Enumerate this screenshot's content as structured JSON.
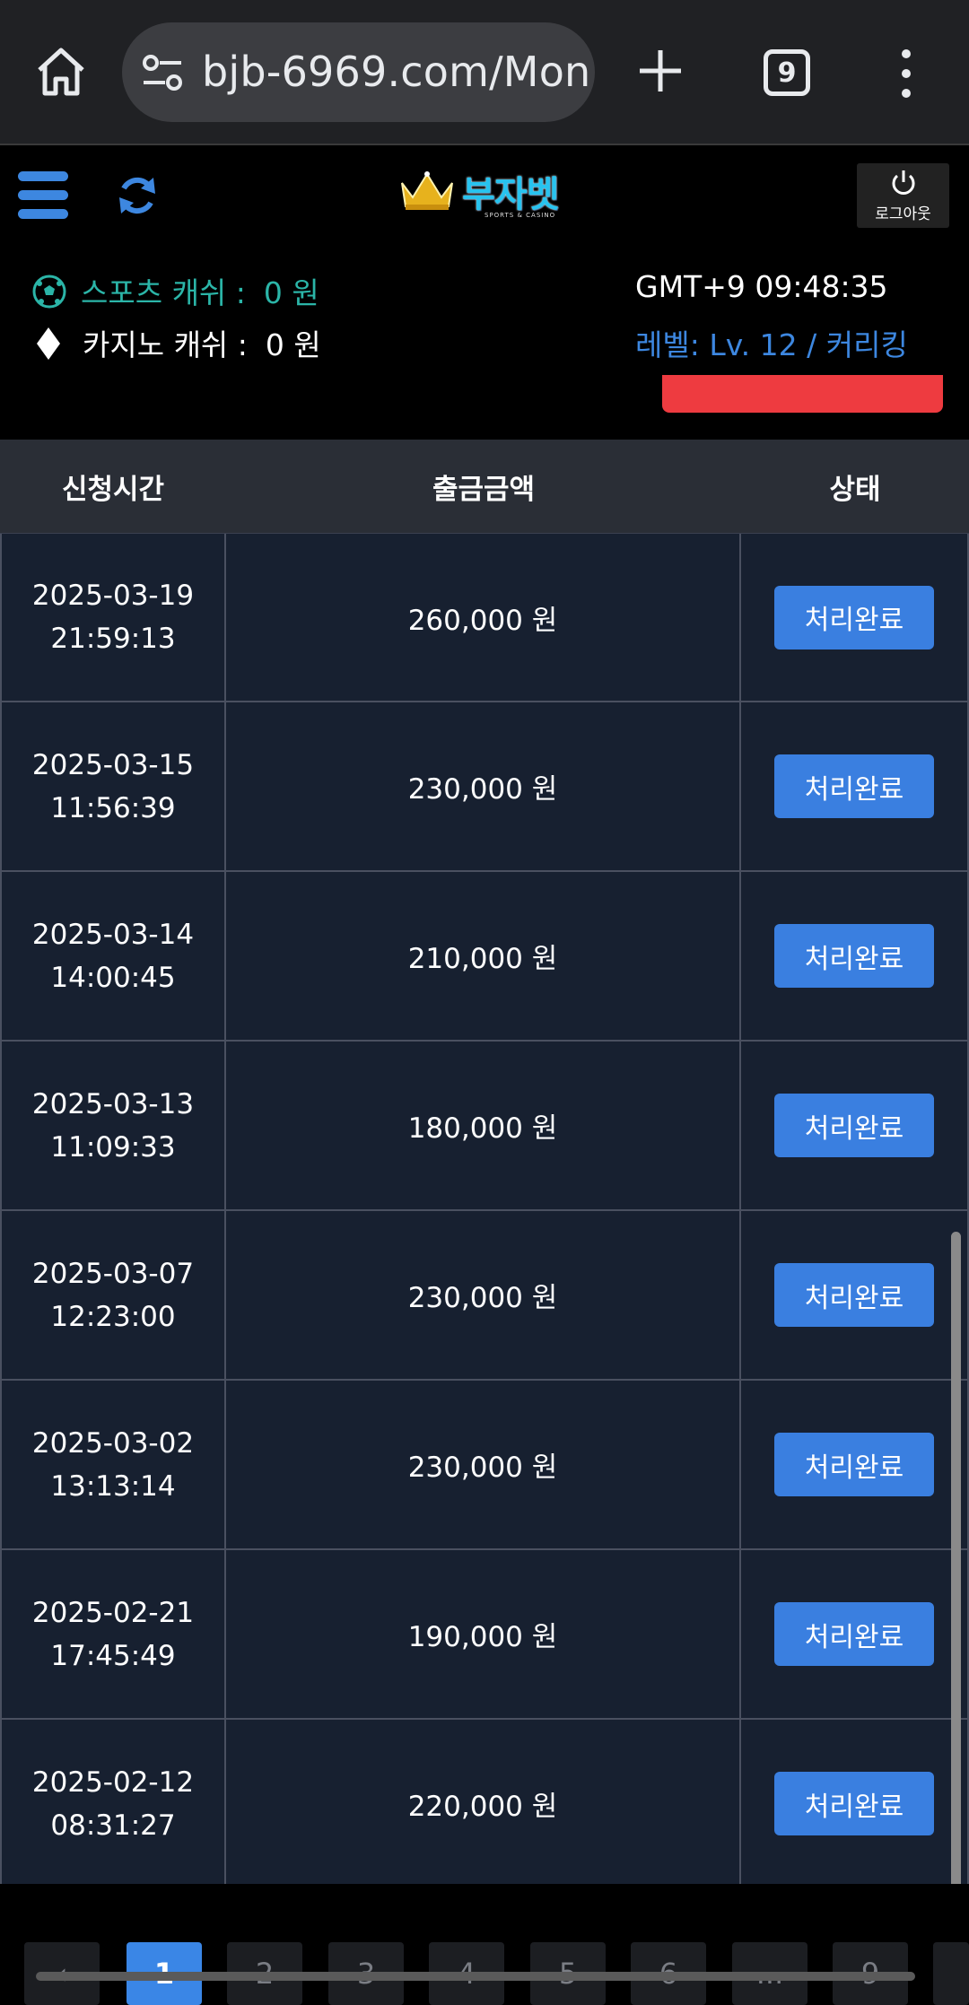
{
  "browser": {
    "url": "bjb-6969.com/Mon",
    "tab_count": "9"
  },
  "header": {
    "logo_text": "부자벳",
    "logo_sub": "SPORTS & CASINO",
    "logout_label": "로그아웃",
    "sports_label": "스포츠 캐쉬 :",
    "sports_value": "0 원",
    "casino_label": "카지노 캐쉬 :",
    "casino_value": "0 원",
    "time": "GMT+9 09:48:35",
    "level": "레벨: Lv. 12 / 커리킹",
    "accent_color": "#3d87e0",
    "sports_color": "#2bb5a8"
  },
  "table": {
    "columns": [
      "신청시간",
      "출금금액",
      "상태"
    ],
    "rows": [
      {
        "date": "2025-03-19",
        "time": "21:59:13",
        "amount": "260,000 원",
        "status": "처리완료"
      },
      {
        "date": "2025-03-15",
        "time": "11:56:39",
        "amount": "230,000 원",
        "status": "처리완료"
      },
      {
        "date": "2025-03-14",
        "time": "14:00:45",
        "amount": "210,000 원",
        "status": "처리완료"
      },
      {
        "date": "2025-03-13",
        "time": "11:09:33",
        "amount": "180,000 원",
        "status": "처리완료"
      },
      {
        "date": "2025-03-07",
        "time": "12:23:00",
        "amount": "230,000 원",
        "status": "처리완료"
      },
      {
        "date": "2025-03-02",
        "time": "13:13:14",
        "amount": "230,000 원",
        "status": "처리완료"
      },
      {
        "date": "2025-02-21",
        "time": "17:45:49",
        "amount": "190,000 원",
        "status": "처리완료"
      },
      {
        "date": "2025-02-12",
        "time": "08:31:27",
        "amount": "220,000 원",
        "status": "처리완료"
      }
    ]
  },
  "pagination": {
    "prev": "‹",
    "pages": [
      "1",
      "2",
      "3",
      "4",
      "5",
      "6",
      "...",
      "9"
    ],
    "active": "1"
  }
}
